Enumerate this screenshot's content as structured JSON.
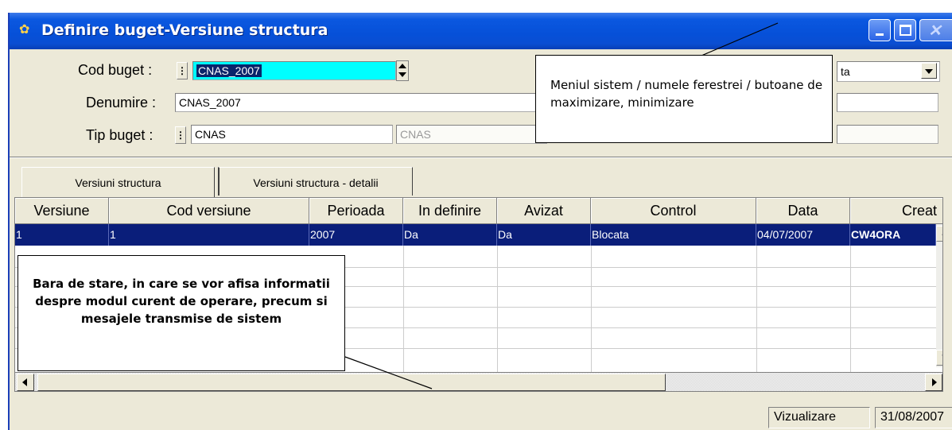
{
  "window": {
    "title": "Definire buget-Versiune structura"
  },
  "form": {
    "cod_buget_label": "Cod buget :",
    "cod_buget_value": "CNAS_2007",
    "denumire_label": "Denumire :",
    "denumire_value": "CNAS_2007",
    "tip_buget_label": "Tip buget :",
    "tip_buget_value": "CNAS",
    "tip_buget_desc": "CNAS",
    "status_select_value": "ta",
    "lov_glyph": "⋮"
  },
  "tabs": [
    {
      "label": "Versiuni structura",
      "active": true
    },
    {
      "label": "Versiuni structura - detalii",
      "active": false
    }
  ],
  "grid": {
    "columns": [
      "Versiune",
      "Cod versiune",
      "Perioada",
      "In definire",
      "Avizat",
      "Control",
      "Data",
      "Creat"
    ],
    "rows": [
      [
        "1",
        "1",
        "2007",
        "Da",
        "Da",
        "Blocata",
        "04/07/2007",
        "CW4ORA"
      ]
    ]
  },
  "status_bar": {
    "mode": "Vizualizare",
    "date": "31/08/2007"
  },
  "annotations": {
    "window_callout": "Meniul sistem / numele ferestrei / butoane de maximizare, minimizare",
    "status_callout": "Bara de  stare, in care se vor afisa informatii despre modul curent de operare, precum si mesajele transmise de sistem"
  },
  "icons": [
    "app-icon",
    "minimize-icon",
    "maximize-icon",
    "close-icon",
    "spin-icon",
    "dropdown-icon",
    "scroll-left-icon",
    "scroll-right-icon",
    "scroll-up-icon",
    "scroll-down-icon"
  ]
}
